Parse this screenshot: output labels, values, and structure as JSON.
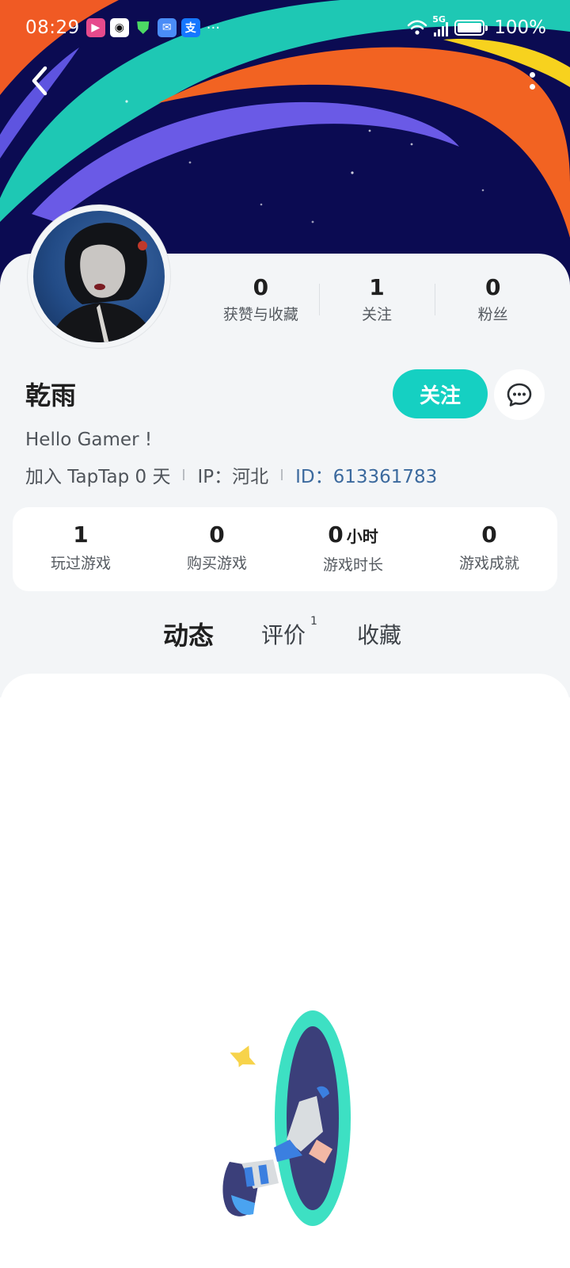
{
  "status_bar": {
    "time": "08:29",
    "network": "5G",
    "battery": "100%",
    "notification_apps": [
      "video-app-icon",
      "qq-icon",
      "shield-icon",
      "mail-icon",
      "alipay-icon"
    ],
    "more": "···"
  },
  "header": {
    "back_icon": "chevron-left-icon",
    "more_icon": "vertical-dots-icon"
  },
  "profile": {
    "name": "乾雨",
    "bio": "Hello Gamer !",
    "join_text": "加入 TapTap 0 天",
    "ip_text": "IP：河北",
    "id_label": "ID：",
    "id_value": "613361783",
    "follow_button": "关注",
    "message_icon": "chat-bubble-icon",
    "stats": [
      {
        "value": "0",
        "label": "获赞与收藏"
      },
      {
        "value": "1",
        "label": "关注"
      },
      {
        "value": "0",
        "label": "粉丝"
      }
    ]
  },
  "game_stats": [
    {
      "value": "1",
      "unit": "",
      "label": "玩过游戏"
    },
    {
      "value": "0",
      "unit": "",
      "label": "购买游戏"
    },
    {
      "value": "0",
      "unit": "小时",
      "label": "游戏时长"
    },
    {
      "value": "0",
      "unit": "",
      "label": "游戏成就"
    }
  ],
  "tabs": [
    {
      "label": "动态",
      "badge": "",
      "active": true
    },
    {
      "label": "评价",
      "badge": "1",
      "active": false
    },
    {
      "label": "收藏",
      "badge": "",
      "active": false
    }
  ],
  "colors": {
    "accent": "#15d0c2",
    "banner_bg": "#0b0b52",
    "id_blue": "#3c6a9e"
  }
}
